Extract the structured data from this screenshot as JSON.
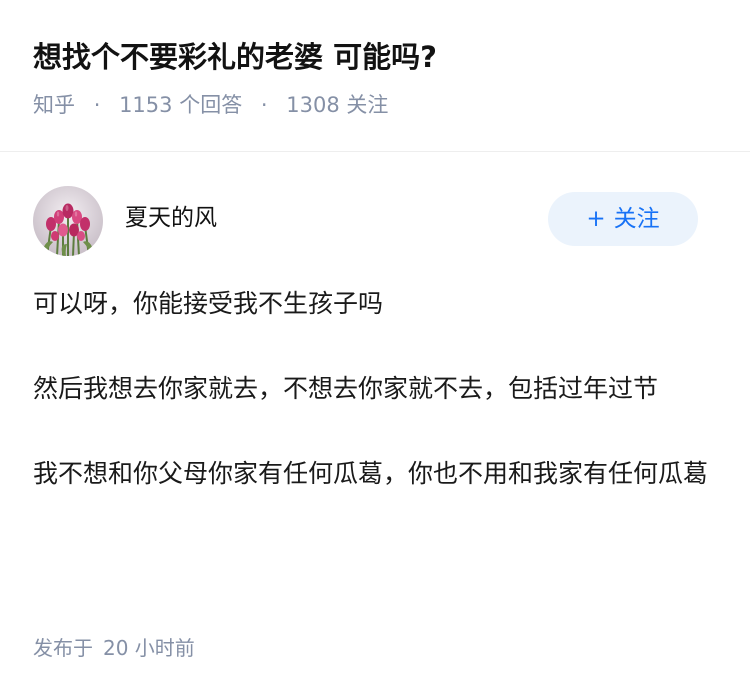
{
  "question": {
    "title": "想找个不要彩礼的老婆 可能吗?",
    "source": "知乎",
    "answer_count": "1153",
    "answer_label": "个回答",
    "follower_count": "1308",
    "follower_label": "关注",
    "separator": "·"
  },
  "author": {
    "name": "夏天的风",
    "avatar_icon": "tulip-bouquet-avatar",
    "follow_plus": "+",
    "follow_label": "关注"
  },
  "answer": {
    "paragraphs": [
      "可以呀，你能接受我不生孩子吗",
      "然后我想去你家就去，不想去你家就不去，包括过年过节",
      "我不想和你父母你家有任何瓜葛，你也不用和我家有任何瓜葛"
    ],
    "published_prefix": "发布于",
    "published_time": "20 小时前"
  },
  "colors": {
    "meta_gray": "#8590a6",
    "brand_blue": "#1772f6",
    "follow_bg": "#ebf3fc"
  }
}
